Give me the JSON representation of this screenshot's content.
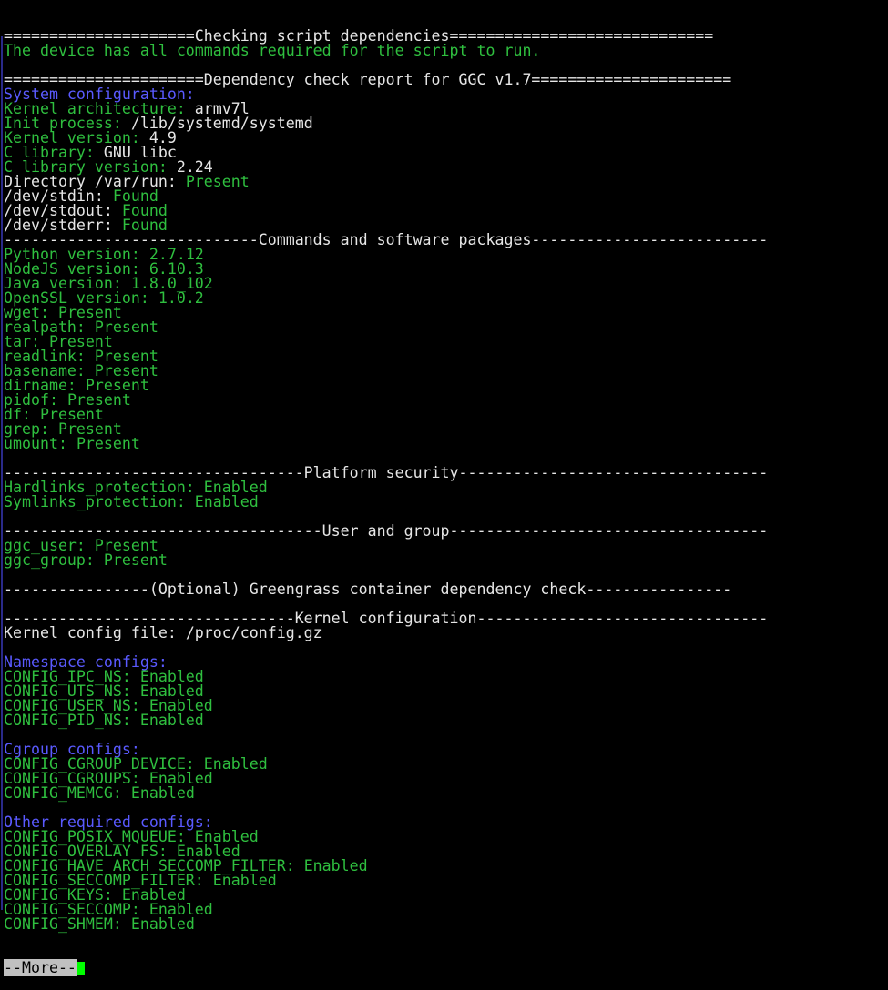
{
  "colors": {
    "background": "#000000",
    "default_text": "#e6e6e6",
    "status_green": "#2fbf3f",
    "section_blue": "#5a5aff",
    "more_prompt_bg": "#c0c0c0",
    "cursor": "#00ff00"
  },
  "lines": [
    {
      "type": "kv",
      "label": "=====================Checking script dependencies=============================",
      "label_color": "w"
    },
    {
      "type": "kv",
      "label": "The device has all commands required for the script to run.",
      "label_color": "g"
    },
    {
      "type": "blank"
    },
    {
      "type": "kv",
      "label": "======================Dependency check report for GGC v1.7======================",
      "label_color": "w"
    },
    {
      "type": "kv",
      "label": "System configuration:",
      "label_color": "b"
    },
    {
      "type": "kv",
      "label": "Kernel architecture: ",
      "label_color": "g",
      "value": "armv7l",
      "value_color": "w"
    },
    {
      "type": "kv",
      "label": "Init process: ",
      "label_color": "g",
      "value": "/lib/systemd/systemd",
      "value_color": "w"
    },
    {
      "type": "kv",
      "label": "Kernel version: ",
      "label_color": "g",
      "value": "4.9",
      "value_color": "w"
    },
    {
      "type": "kv",
      "label": "C library: ",
      "label_color": "g",
      "value": "GNU libc",
      "value_color": "w"
    },
    {
      "type": "kv",
      "label": "C library version: ",
      "label_color": "g",
      "value": "2.24",
      "value_color": "w"
    },
    {
      "type": "kv",
      "label": "Directory /var/run: ",
      "label_color": "w",
      "value": "Present",
      "value_color": "g"
    },
    {
      "type": "kv",
      "label": "/dev/stdin: ",
      "label_color": "w",
      "value": "Found",
      "value_color": "g"
    },
    {
      "type": "kv",
      "label": "/dev/stdout: ",
      "label_color": "w",
      "value": "Found",
      "value_color": "g"
    },
    {
      "type": "kv",
      "label": "/dev/stderr: ",
      "label_color": "w",
      "value": "Found",
      "value_color": "g"
    },
    {
      "type": "kv",
      "label": "----------------------------Commands and software packages--------------------------",
      "label_color": "w"
    },
    {
      "type": "kv",
      "label": "Python version: ",
      "label_color": "g",
      "value": "2.7.12",
      "value_color": "g"
    },
    {
      "type": "kv",
      "label": "NodeJS version: ",
      "label_color": "g",
      "value": "6.10.3",
      "value_color": "g"
    },
    {
      "type": "kv",
      "label": "Java version: ",
      "label_color": "g",
      "value": "1.8.0_102",
      "value_color": "g"
    },
    {
      "type": "kv",
      "label": "OpenSSL version: ",
      "label_color": "g",
      "value": "1.0.2",
      "value_color": "g"
    },
    {
      "type": "kv",
      "label": "wget: ",
      "label_color": "g",
      "value": "Present",
      "value_color": "g"
    },
    {
      "type": "kv",
      "label": "realpath: ",
      "label_color": "g",
      "value": "Present",
      "value_color": "g"
    },
    {
      "type": "kv",
      "label": "tar: ",
      "label_color": "g",
      "value": "Present",
      "value_color": "g"
    },
    {
      "type": "kv",
      "label": "readlink: ",
      "label_color": "g",
      "value": "Present",
      "value_color": "g"
    },
    {
      "type": "kv",
      "label": "basename: ",
      "label_color": "g",
      "value": "Present",
      "value_color": "g"
    },
    {
      "type": "kv",
      "label": "dirname: ",
      "label_color": "g",
      "value": "Present",
      "value_color": "g"
    },
    {
      "type": "kv",
      "label": "pidof: ",
      "label_color": "g",
      "value": "Present",
      "value_color": "g"
    },
    {
      "type": "kv",
      "label": "df: ",
      "label_color": "g",
      "value": "Present",
      "value_color": "g"
    },
    {
      "type": "kv",
      "label": "grep: ",
      "label_color": "g",
      "value": "Present",
      "value_color": "g"
    },
    {
      "type": "kv",
      "label": "umount: ",
      "label_color": "g",
      "value": "Present",
      "value_color": "g"
    },
    {
      "type": "blank"
    },
    {
      "type": "kv",
      "label": "---------------------------------Platform security----------------------------------",
      "label_color": "w"
    },
    {
      "type": "kv",
      "label": "Hardlinks_protection: ",
      "label_color": "g",
      "value": "Enabled",
      "value_color": "g"
    },
    {
      "type": "kv",
      "label": "Symlinks_protection: ",
      "label_color": "g",
      "value": "Enabled",
      "value_color": "g"
    },
    {
      "type": "blank"
    },
    {
      "type": "kv",
      "label": "-----------------------------------User and group-----------------------------------",
      "label_color": "w"
    },
    {
      "type": "kv",
      "label": "ggc_user: ",
      "label_color": "g",
      "value": "Present",
      "value_color": "g"
    },
    {
      "type": "kv",
      "label": "ggc_group: ",
      "label_color": "g",
      "value": "Present",
      "value_color": "g"
    },
    {
      "type": "blank"
    },
    {
      "type": "kv",
      "label": "----------------(Optional) Greengrass container dependency check----------------",
      "label_color": "w"
    },
    {
      "type": "blank"
    },
    {
      "type": "kv",
      "label": "--------------------------------Kernel configuration--------------------------------",
      "label_color": "w"
    },
    {
      "type": "kv",
      "label": "Kernel config file: ",
      "label_color": "w",
      "value": "/proc/config.gz",
      "value_color": "w"
    },
    {
      "type": "blank"
    },
    {
      "type": "kv",
      "label": "Namespace configs:",
      "label_color": "b"
    },
    {
      "type": "kv",
      "label": "CONFIG_IPC_NS: ",
      "label_color": "g",
      "value": "Enabled",
      "value_color": "g"
    },
    {
      "type": "kv",
      "label": "CONFIG_UTS_NS: ",
      "label_color": "g",
      "value": "Enabled",
      "value_color": "g"
    },
    {
      "type": "kv",
      "label": "CONFIG_USER_NS: ",
      "label_color": "g",
      "value": "Enabled",
      "value_color": "g"
    },
    {
      "type": "kv",
      "label": "CONFIG_PID_NS: ",
      "label_color": "g",
      "value": "Enabled",
      "value_color": "g"
    },
    {
      "type": "blank"
    },
    {
      "type": "kv",
      "label": "Cgroup configs:",
      "label_color": "b"
    },
    {
      "type": "kv",
      "label": "CONFIG_CGROUP_DEVICE: ",
      "label_color": "g",
      "value": "Enabled",
      "value_color": "g"
    },
    {
      "type": "kv",
      "label": "CONFIG_CGROUPS: ",
      "label_color": "g",
      "value": "Enabled",
      "value_color": "g"
    },
    {
      "type": "kv",
      "label": "CONFIG_MEMCG: ",
      "label_color": "g",
      "value": "Enabled",
      "value_color": "g"
    },
    {
      "type": "blank"
    },
    {
      "type": "kv",
      "label": "Other required configs:",
      "label_color": "b"
    },
    {
      "type": "kv",
      "label": "CONFIG_POSIX_MQUEUE: ",
      "label_color": "g",
      "value": "Enabled",
      "value_color": "g"
    },
    {
      "type": "kv",
      "label": "CONFIG_OVERLAY_FS: ",
      "label_color": "g",
      "value": "Enabled",
      "value_color": "g"
    },
    {
      "type": "kv",
      "label": "CONFIG_HAVE_ARCH_SECCOMP_FILTER: ",
      "label_color": "g",
      "value": "Enabled",
      "value_color": "g"
    },
    {
      "type": "kv",
      "label": "CONFIG_SECCOMP_FILTER: ",
      "label_color": "g",
      "value": "Enabled",
      "value_color": "g"
    },
    {
      "type": "kv",
      "label": "CONFIG_KEYS: ",
      "label_color": "g",
      "value": "Enabled",
      "value_color": "g"
    },
    {
      "type": "kv",
      "label": "CONFIG_SECCOMP: ",
      "label_color": "g",
      "value": "Enabled",
      "value_color": "g"
    },
    {
      "type": "kv",
      "label": "CONFIG_SHMEM: ",
      "label_color": "g",
      "value": "Enabled",
      "value_color": "g"
    }
  ],
  "pager": {
    "prompt": "--More--"
  }
}
